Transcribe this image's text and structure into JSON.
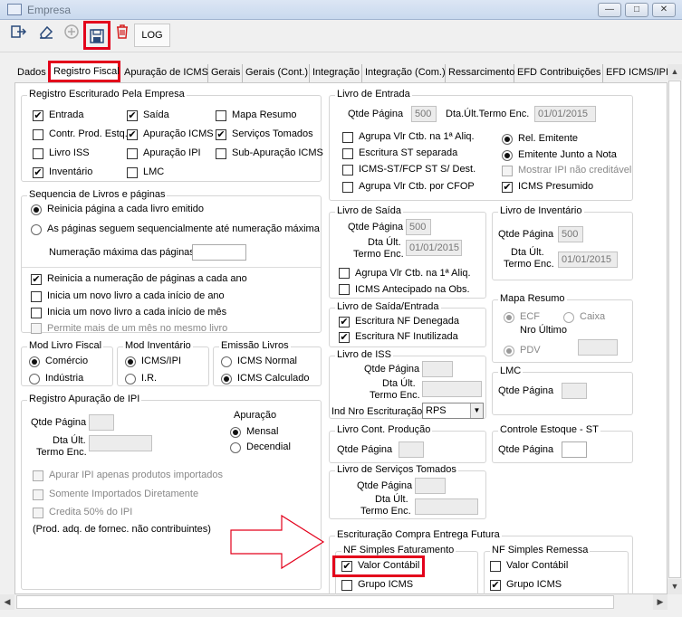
{
  "window": {
    "title": "Empresa",
    "min_glyph": "—",
    "max_glyph": "□",
    "close_glyph": "✕"
  },
  "toolbar": {
    "log_label": "LOG"
  },
  "tabs": [
    "Dados",
    "Registro Fiscal",
    "Apuração de ICMS",
    "Gerais",
    "Gerais (Cont.)",
    "Integração",
    "Integração (Com.)",
    "Ressarcimento",
    "EFD Contribuições",
    "EFD ICMS/IPI"
  ],
  "registro_escriturado": {
    "title": "Registro Escriturado Pela Empresa",
    "items": [
      {
        "label": "Entrada",
        "checked": true
      },
      {
        "label": "Saída",
        "checked": true
      },
      {
        "label": "Mapa Resumo",
        "checked": false
      },
      {
        "label": "Contr. Prod. Estq.",
        "checked": false
      },
      {
        "label": "Apuração ICMS",
        "checked": true
      },
      {
        "label": "Serviços Tomados",
        "checked": true
      },
      {
        "label": "Livro ISS",
        "checked": false
      },
      {
        "label": "Apuração IPI",
        "checked": false
      },
      {
        "label": "Sub-Apuração ICMS",
        "checked": false
      },
      {
        "label": "Inventário",
        "checked": true
      },
      {
        "label": "LMC",
        "checked": false
      }
    ]
  },
  "sequencia": {
    "title": "Sequencia de Livros e páginas",
    "radio1": "Reinicia página a cada livro emitido",
    "radio2": "As páginas seguem sequencialmente até numeração máxima",
    "max_label": "Numeração máxima das páginas",
    "max_value": "",
    "cb1": "Reinicia a numeração de páginas a cada ano",
    "cb2": "Inicia um novo livro a cada início de ano",
    "cb3": "Inicia um novo livro a cada início de mês",
    "cb4": "Permite mais de um mês no mesmo livro"
  },
  "mod_livro": {
    "title": "Mod Livro Fiscal",
    "opt1": "Comércio",
    "opt2": "Indústria"
  },
  "mod_inv": {
    "title": "Mod Inventário",
    "opt1": "ICMS/IPI",
    "opt2": "I.R."
  },
  "emissao": {
    "title": "Emissão Livros",
    "opt1": "ICMS Normal",
    "opt2": "ICMS Calculado"
  },
  "reg_ipi": {
    "title": "Registro Apuração de IPI",
    "qtde_label": "Qtde Página",
    "dta_label1": "Dta Últ.",
    "dta_label2": "Termo Enc.",
    "apuracao_label": "Apuração",
    "opt1": "Mensal",
    "opt2": "Decendial",
    "cb1": "Apurar IPI apenas produtos importados",
    "cb2": "Somente Importados Diretamente",
    "cb3": "Credita 50% do IPI",
    "note": "(Prod. adq. de fornec. não contribuintes)"
  },
  "livro_entrada": {
    "title": "Livro de Entrada",
    "qtde_label": "Qtde Página",
    "qtde_value": "500",
    "dta_label": "Dta.Últ.Termo Enc.",
    "dta_value": "01/01/2015",
    "cb1": "Agrupa Vlr Ctb. na 1ª Aliq.",
    "cb2": "Escritura ST separada",
    "cb3": "ICMS-ST/FCP ST S/ Dest.",
    "cb4": "Agrupa Vlr Ctb. por CFOP",
    "r1": "Rel. Emitente",
    "r2": "Emitente Junto a Nota",
    "cb5": "Mostrar IPI não creditável",
    "cb6": "ICMS Presumido"
  },
  "livro_saida": {
    "title": "Livro de Saída",
    "qtde_label": "Qtde Página",
    "qtde_value": "500",
    "dta_label1": "Dta Últ.",
    "dta_label2": "Termo Enc.",
    "dta_value": "01/01/2015",
    "cb1": "Agrupa Vlr Ctb. na 1ª Aliq.",
    "cb2": "ICMS Antecipado na Obs."
  },
  "livro_inventario": {
    "title": "Livro de Inventário",
    "qtde_label": "Qtde Página",
    "qtde_value": "500",
    "dta_label1": "Dta Últ.",
    "dta_label2": "Termo Enc.",
    "dta_value": "01/01/2015"
  },
  "saida_entrada": {
    "title": "Livro de Saída/Entrada",
    "cb1": "Escritura NF Denegada",
    "cb2": "Escritura NF Inutilizada"
  },
  "mapa_resumo": {
    "title": "Mapa Resumo",
    "r1": "ECF",
    "r2": "Caixa",
    "nro_label": "Nro Último",
    "r3": "PDV"
  },
  "livro_iss": {
    "title": "Livro de ISS",
    "qtde_label": "Qtde Página",
    "dta_label1": "Dta Últ.",
    "dta_label2": "Termo Enc.",
    "ind_label": "Ind Nro Escrituração",
    "ind_value": "RPS"
  },
  "lmc": {
    "title": "LMC",
    "qtde_label": "Qtde Página"
  },
  "cont_producao": {
    "title": "Livro Cont. Produção",
    "qtde_label": "Qtde Página"
  },
  "controle_estoque": {
    "title": "Controle Estoque - ST",
    "qtde_label": "Qtde Página"
  },
  "servicos_tomados": {
    "title": "Livro de Serviços Tomados",
    "qtde_label": "Qtde Página",
    "dta_label1": "Dta Últ.",
    "dta_label2": "Termo Enc."
  },
  "compra_entrega": {
    "title": "Escrituração Compra Entrega Futura",
    "fat_title": "NF Simples Faturamento",
    "fat_cb1": "Valor Contábil",
    "fat_cb2": "Grupo ICMS",
    "rem_title": "NF Simples Remessa",
    "rem_cb1": "Valor Contábil",
    "rem_cb2": "Grupo ICMS"
  },
  "colors": {
    "highlight": "#e3001b"
  }
}
